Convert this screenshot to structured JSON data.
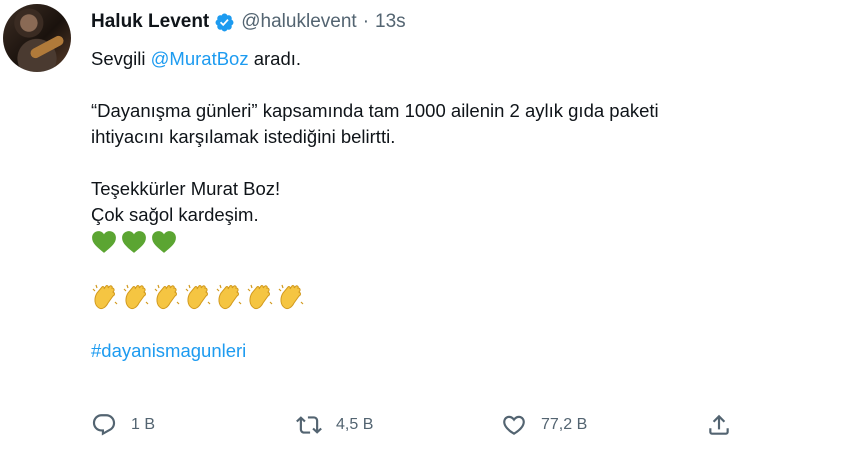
{
  "user": {
    "display_name": "Haluk Levent",
    "handle": "@haluklevent",
    "separator": "·",
    "time": "13s"
  },
  "tweet": {
    "line1_prefix": "Sevgili ",
    "line1_mention": "@MuratBoz",
    "line1_suffix": " aradı.",
    "line2": "“Dayanışma günleri” kapsamında tam 1000 ailenin 2 aylık gıda paketi",
    "line3": "ihtiyacını karşılamak istediğini belirtti.",
    "line4": "Teşekkürler Murat Boz!",
    "line5": "Çok sağol kardeşim.",
    "heart_count": 3,
    "heart_color": "#5ba532",
    "clap_count": 7,
    "clap_color": "#f5c542",
    "hashtag": "#dayanismagunleri"
  },
  "actions": {
    "reply_count": "1 B",
    "retweet_count": "4,5 B",
    "like_count": "77,2 B"
  },
  "icons": [
    "verified-icon",
    "reply-icon",
    "retweet-icon",
    "like-icon",
    "share-icon"
  ],
  "colors": {
    "link": "#1d9bf0",
    "secondary_text": "#536471",
    "verified": "#1d9bf0"
  }
}
